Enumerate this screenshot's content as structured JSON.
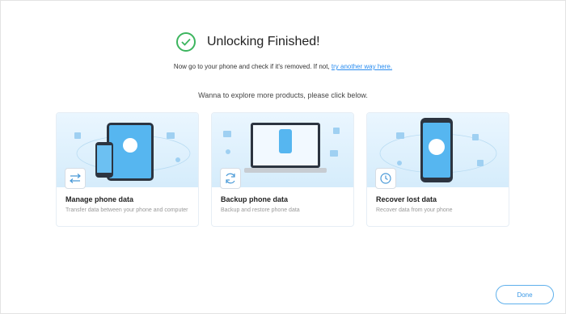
{
  "header": {
    "title": "Unlocking Finished!"
  },
  "instructions": {
    "text": "Now go to your phone and check if it's removed. If not,",
    "link_text": "try another way here."
  },
  "explore_prompt": "Wanna to explore more products,  please click below.",
  "cards": [
    {
      "title": "Manage phone data",
      "description": "Transfer data between your phone and computer",
      "icon": "transfer-arrows-icon"
    },
    {
      "title": "Backup phone data",
      "description": "Backup and restore phone data",
      "icon": "refresh-cycle-icon"
    },
    {
      "title": "Recover lost data",
      "description": "Recover data from your phone",
      "icon": "clock-history-icon"
    }
  ],
  "done_button": "Done",
  "colors": {
    "success": "#3cb55e",
    "link": "#2a8df0",
    "accent": "#3a99e6"
  }
}
